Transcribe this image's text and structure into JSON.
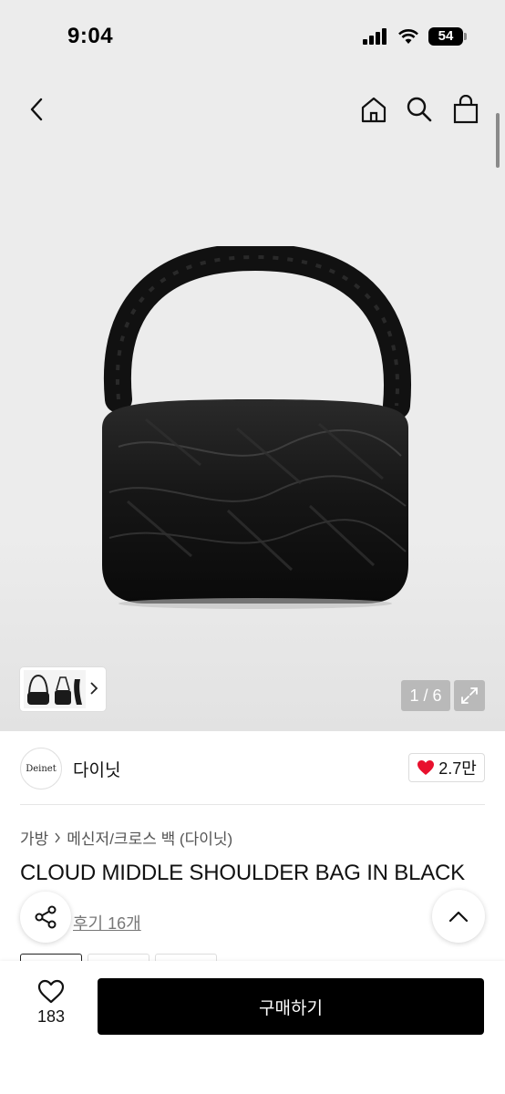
{
  "status_bar": {
    "time": "9:04",
    "battery": "54"
  },
  "header": {
    "back_icon": "chevron-left-icon",
    "home_icon": "home-icon",
    "search_icon": "search-icon",
    "cart_icon": "shopping-bag-icon"
  },
  "gallery": {
    "counter": "1 / 6",
    "expand_icon": "expand-icon"
  },
  "brand": {
    "logo_text": "Deinet",
    "name": "다이닛",
    "likes": "2.7만",
    "heart_color": "#e8102d"
  },
  "breadcrumb": {
    "category": "가방",
    "subcategory": "메신저/크로스 백 (다이닛)"
  },
  "product": {
    "title": "CLOUD MIDDLE SHOULDER BAG IN BLACK",
    "reviews": "후기 16개"
  },
  "bottom_bar": {
    "wish_count": "183",
    "buy_label": "구매하기"
  }
}
